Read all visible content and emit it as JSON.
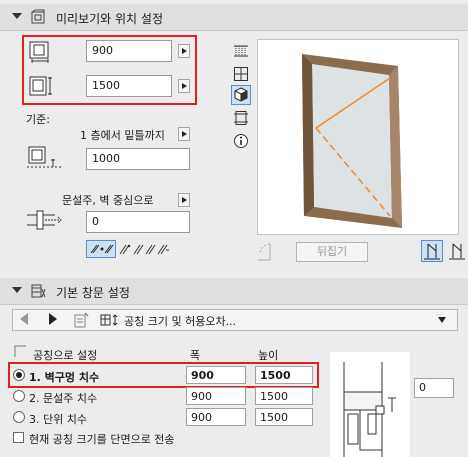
{
  "preview_section": {
    "title": "미리보기와 위치 설정",
    "width_value": "900",
    "height_value": "1500",
    "reference_label": "기준:",
    "reference_option": "1 층에서 밑틀까지",
    "sill_value": "1000",
    "anchor_option": "문설주, 벽 중심으로",
    "offset_value": "0",
    "flip_button": "뒤집기"
  },
  "frame_section": {
    "title": "기본 창문 설정",
    "dropdown_label": "공칭 크기 및 허용오차...",
    "nominal_label": "공칭으로 설정",
    "col_width": "폭",
    "col_height": "높이",
    "rows": [
      {
        "label": "1. 벽구멍 치수",
        "width": "900",
        "height": "1500",
        "selected": true
      },
      {
        "label": "2. 문설주 치수",
        "width": "900",
        "height": "1500",
        "selected": false
      },
      {
        "label": "3. 단위 치수",
        "width": "900",
        "height": "1500",
        "selected": false
      }
    ],
    "transfer_label": "현재 공칭 크기를 단면으로 전송",
    "side_value": "0"
  },
  "colors": {
    "highlight": "#e0201c",
    "frame_wood": "#8a6c4e",
    "opening_line": "#f08a2c",
    "glass": "#dde2e4"
  }
}
